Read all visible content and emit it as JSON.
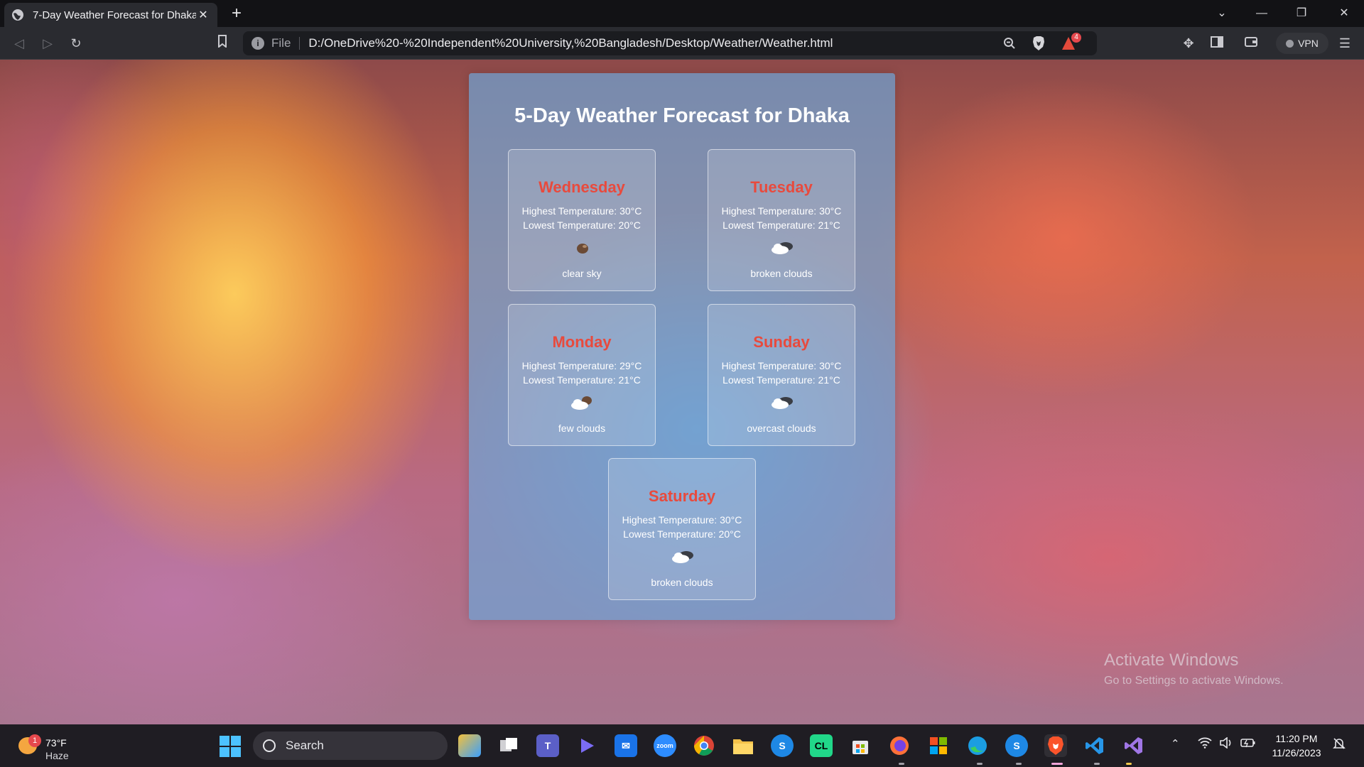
{
  "browser": {
    "tab_title": "7-Day Weather Forecast for Dhaka",
    "scheme": "File",
    "url": "D:/OneDrive%20-%20Independent%20University,%20Bangladesh/Desktop/Weather/Weather.html",
    "shield_badge": "4",
    "vpn_label": "VPN"
  },
  "page": {
    "title": "5-Day Weather Forecast for Dhaka",
    "days": [
      {
        "day": "Wednesday",
        "hi": "Highest Temperature: 30°C",
        "lo": "Lowest Temperature: 20°C",
        "icon": "sun-icon",
        "desc": "clear sky"
      },
      {
        "day": "Tuesday",
        "hi": "Highest Temperature: 30°C",
        "lo": "Lowest Temperature: 21°C",
        "icon": "cloud-icon",
        "desc": "broken clouds"
      },
      {
        "day": "Monday",
        "hi": "Highest Temperature: 29°C",
        "lo": "Lowest Temperature: 21°C",
        "icon": "partly-cloudy-icon",
        "desc": "few clouds"
      },
      {
        "day": "Sunday",
        "hi": "Highest Temperature: 30°C",
        "lo": "Lowest Temperature: 21°C",
        "icon": "cloud-icon",
        "desc": "overcast clouds"
      },
      {
        "day": "Saturday",
        "hi": "Highest Temperature: 30°C",
        "lo": "Lowest Temperature: 20°C",
        "icon": "cloud-icon",
        "desc": "broken clouds"
      }
    ]
  },
  "watermark": {
    "line1": "Activate Windows",
    "line2": "Go to Settings to activate Windows."
  },
  "taskbar": {
    "weather_temp": "73°F",
    "weather_cond": "Haze",
    "weather_badge": "1",
    "search_label": "Search",
    "time": "11:20 PM",
    "date": "11/26/2023"
  },
  "colors": {
    "day_heading": "#e84a3d",
    "panel": "#6ea5d7"
  }
}
